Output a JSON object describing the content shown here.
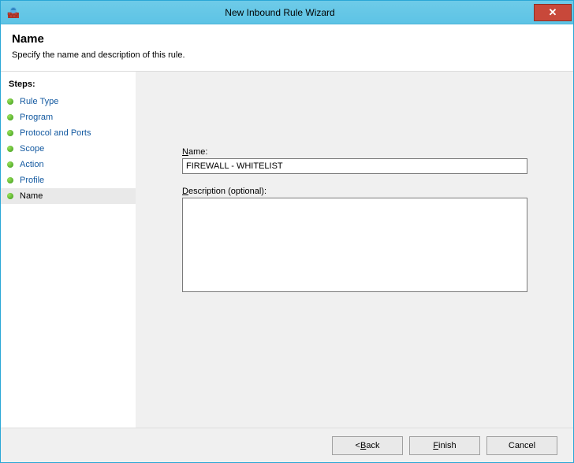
{
  "window": {
    "title": "New Inbound Rule Wizard"
  },
  "header": {
    "title": "Name",
    "description": "Specify the name and description of this rule."
  },
  "sidebar": {
    "heading": "Steps:",
    "steps": [
      {
        "label": "Rule Type",
        "current": false
      },
      {
        "label": "Program",
        "current": false
      },
      {
        "label": "Protocol and Ports",
        "current": false
      },
      {
        "label": "Scope",
        "current": false
      },
      {
        "label": "Action",
        "current": false
      },
      {
        "label": "Profile",
        "current": false
      },
      {
        "label": "Name",
        "current": true
      }
    ]
  },
  "form": {
    "name_label_prefix": "N",
    "name_label_rest": "ame:",
    "name_value": "FIREWALL - WHITELIST",
    "desc_label_prefix": "D",
    "desc_label_rest": "escription (optional):",
    "desc_value": ""
  },
  "buttons": {
    "back_prefix": "< ",
    "back_mn": "B",
    "back_rest": "ack",
    "finish_mn": "F",
    "finish_rest": "inish",
    "cancel": "Cancel"
  }
}
